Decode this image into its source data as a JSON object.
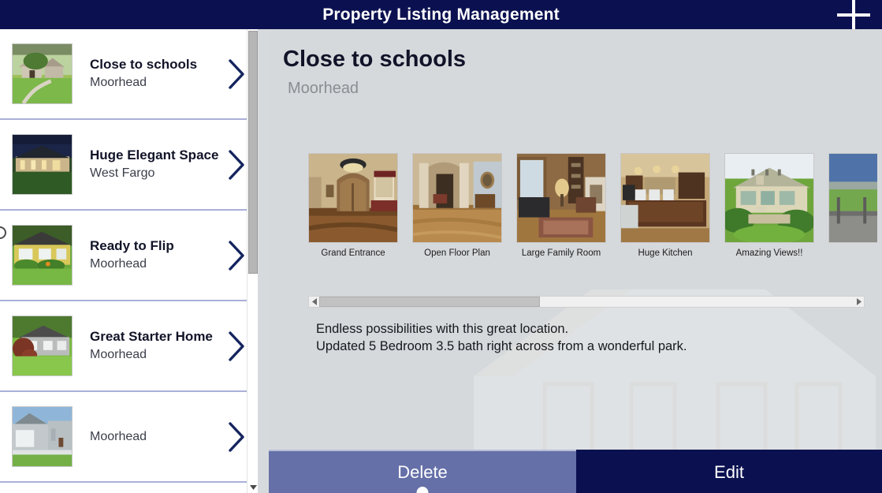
{
  "header": {
    "title": "Property Listing Management",
    "add_icon": "plus-icon",
    "background": "#0b1150",
    "text_color": "#ffffff"
  },
  "sidebar": {
    "scrollbar": {
      "orientation": "vertical",
      "down_arrow_icon": "caret-down-icon"
    },
    "chevron_icon": "chevron-right-icon",
    "items": [
      {
        "title": "Close to schools",
        "subtitle": "Moorhead",
        "thumb": "house-exterior-stone-photo",
        "selected": true
      },
      {
        "title": "Huge Elegant Space",
        "subtitle": "West Fargo",
        "thumb": "house-night-exterior-photo",
        "selected": false
      },
      {
        "title": "Ready to Flip",
        "subtitle": "Moorhead",
        "thumb": "yellow-house-photo",
        "selected": false
      },
      {
        "title": "Great Starter Home",
        "subtitle": "Moorhead",
        "thumb": "gray-ranch-house-photo",
        "selected": false
      },
      {
        "title": "",
        "subtitle": "Moorhead",
        "thumb": "gray-garage-house-photo",
        "selected": false
      }
    ]
  },
  "detail": {
    "title": "Close to schools",
    "subtitle": "Moorhead",
    "watermark": "house-outline-watermark",
    "gallery": {
      "scroll_left_icon": "caret-left-icon",
      "scroll_right_icon": "caret-right-icon",
      "photos": [
        {
          "caption": "Grand Entrance",
          "image": "foyer-arched-door-photo"
        },
        {
          "caption": "Open Floor Plan",
          "image": "hallway-columns-photo"
        },
        {
          "caption": "Large Family Room",
          "image": "living-room-fireplace-photo"
        },
        {
          "caption": "Huge Kitchen",
          "image": "kitchen-dining-table-photo"
        },
        {
          "caption": "Amazing Views!!",
          "image": "backyard-house-exterior-photo"
        },
        {
          "caption": "",
          "image": "deck-view-photo"
        }
      ]
    },
    "description_line1": "Endless possibilities with this great location.",
    "description_line2": "Updated 5 Bedroom 3.5 bath right across from a wonderful park."
  },
  "footer": {
    "delete_label": "Delete",
    "edit_label": "Edit",
    "delete_color": "#6570a8",
    "edit_color": "#0b1150"
  }
}
